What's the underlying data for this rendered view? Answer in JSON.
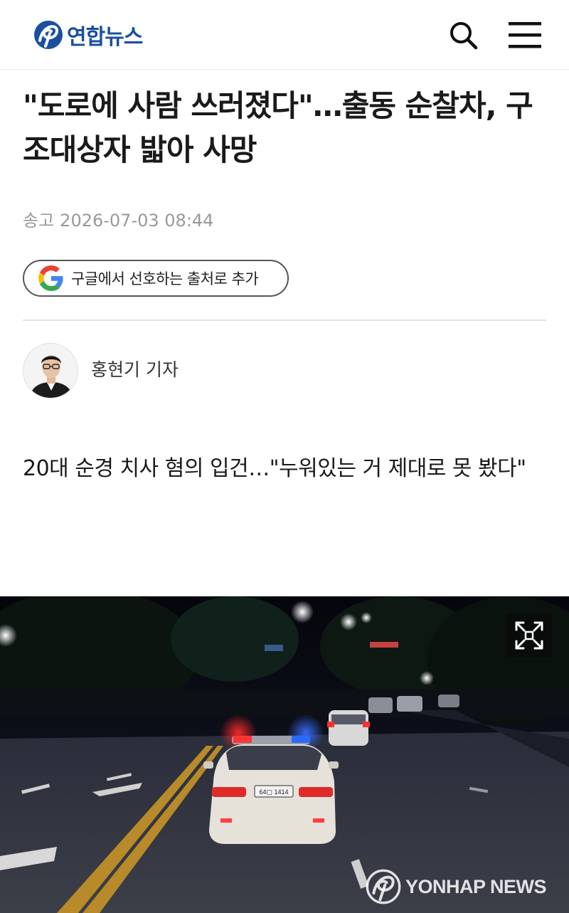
{
  "header": {
    "logo_text": "연합뉴스",
    "logo_icon": "yonhap-logo-icon",
    "search_icon": "search-icon",
    "menu_icon": "hamburger-menu-icon",
    "brand_color": "#1a4fa0"
  },
  "article": {
    "headline": "\"도로에 사람 쓰러졌다\"…출동 순찰차, 구조대상자 밟아 사망",
    "date_label": "송고",
    "date_value": "2026-07-03 08:44",
    "google_button_label": "구글에서 선호하는 출처로 추가",
    "reporter_name": "홍현기 기자",
    "subtitle": "20대 순경 치사 혐의 입건…\"누워있는 거 제대로 못 봤다\""
  },
  "photo": {
    "expand_icon": "expand-icon",
    "watermark_text": "YONHAP NEWS",
    "plate_text": "64▢ 1414"
  }
}
